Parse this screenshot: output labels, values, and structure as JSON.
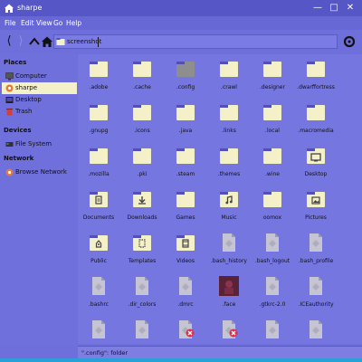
{
  "window": {
    "title": "sharpe"
  },
  "menu": [
    "File",
    "Edit",
    "View",
    "Go",
    "Help"
  ],
  "toolbar": {
    "path": "screenshot"
  },
  "sidebar": {
    "places_heading": "Places",
    "places": [
      {
        "label": "Computer",
        "icon": "computer-icon",
        "selected": false
      },
      {
        "label": "sharpe",
        "icon": "user-home-icon",
        "selected": true
      },
      {
        "label": "Desktop",
        "icon": "desktop-icon",
        "selected": false
      },
      {
        "label": "Trash",
        "icon": "trash-icon",
        "selected": false
      }
    ],
    "devices_heading": "Devices",
    "devices": [
      {
        "label": "File System",
        "icon": "drive-icon"
      }
    ],
    "network_heading": "Network",
    "network": [
      {
        "label": "Browse Network",
        "icon": "network-icon"
      }
    ]
  },
  "items": [
    {
      "label": ".adobe",
      "kind": "folder"
    },
    {
      "label": ".cache",
      "kind": "folder"
    },
    {
      "label": ".config",
      "kind": "folder-selected"
    },
    {
      "label": ".crawl",
      "kind": "folder"
    },
    {
      "label": ".designer",
      "kind": "folder"
    },
    {
      "label": ".dwarffortress",
      "kind": "folder"
    },
    {
      "label": ".gnupg",
      "kind": "folder"
    },
    {
      "label": ".icons",
      "kind": "folder"
    },
    {
      "label": ".java",
      "kind": "folder"
    },
    {
      "label": ".links",
      "kind": "folder"
    },
    {
      "label": ".local",
      "kind": "folder"
    },
    {
      "label": ".macromedia",
      "kind": "folder"
    },
    {
      "label": ".mozilla",
      "kind": "folder"
    },
    {
      "label": ".pki",
      "kind": "folder"
    },
    {
      "label": ".steam",
      "kind": "folder"
    },
    {
      "label": ".themes",
      "kind": "folder"
    },
    {
      "label": ".wine",
      "kind": "folder"
    },
    {
      "label": "Desktop",
      "kind": "folder-desktop"
    },
    {
      "label": "Documents",
      "kind": "folder-documents"
    },
    {
      "label": "Downloads",
      "kind": "folder-downloads"
    },
    {
      "label": "Games",
      "kind": "folder"
    },
    {
      "label": "Music",
      "kind": "folder-music"
    },
    {
      "label": "oomox",
      "kind": "folder"
    },
    {
      "label": "Pictures",
      "kind": "folder-pictures"
    },
    {
      "label": "Public",
      "kind": "folder-public"
    },
    {
      "label": "Templates",
      "kind": "folder-templates"
    },
    {
      "label": "Videos",
      "kind": "folder-videos"
    },
    {
      "label": ".bash_history",
      "kind": "file"
    },
    {
      "label": ".bash_logout",
      "kind": "file"
    },
    {
      "label": ".bash_profile",
      "kind": "file"
    },
    {
      "label": ".bashrc",
      "kind": "file"
    },
    {
      "label": ".dir_colors",
      "kind": "file"
    },
    {
      "label": ".dmrc",
      "kind": "file"
    },
    {
      "label": ".face",
      "kind": "image"
    },
    {
      "label": ".gtkrc-2.0",
      "kind": "file"
    },
    {
      "label": ".ICEauthority",
      "kind": "file"
    },
    {
      "label": "",
      "kind": "file"
    },
    {
      "label": "",
      "kind": "file"
    },
    {
      "label": "",
      "kind": "file-broken"
    },
    {
      "label": "",
      "kind": "file-broken"
    },
    {
      "label": "",
      "kind": "file"
    },
    {
      "label": "",
      "kind": "file"
    }
  ],
  "status": {
    "text": "\".config\": folder"
  },
  "colors": {
    "titlebar": "#5656c6",
    "background": "#6f6fdc",
    "view": "#7676e0",
    "selected": "#f4f0c8",
    "folder_body": "#f4f0c8",
    "folder_tab": "#5050b8",
    "bottom_strip": "#2aa0d8"
  }
}
